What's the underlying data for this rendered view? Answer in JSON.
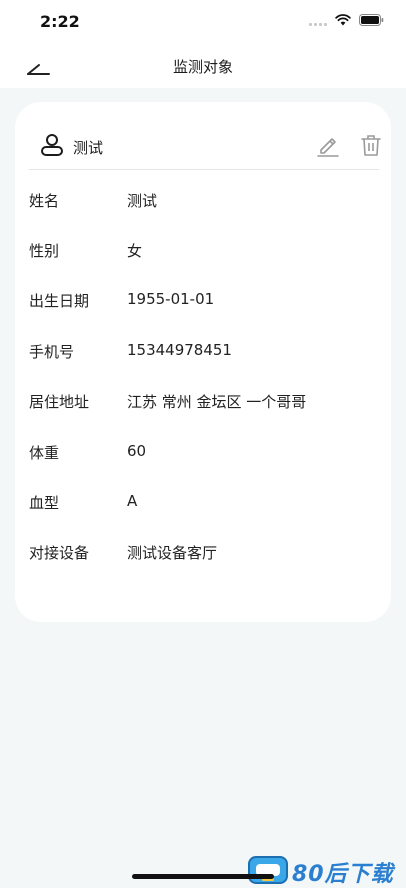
{
  "status_bar": {
    "time": "2:22"
  },
  "nav": {
    "title": "监测对象",
    "back_icon": "back-arrow-icon"
  },
  "profile_header": {
    "name": "测试",
    "icons": [
      "user-icon",
      "edit-icon",
      "trash-icon"
    ]
  },
  "details": [
    {
      "label": "姓名",
      "value": "测试"
    },
    {
      "label": "性别",
      "value": "女"
    },
    {
      "label": "出生日期",
      "value": "1955-01-01"
    },
    {
      "label": "手机号",
      "value": "15344978451"
    },
    {
      "label": "居住地址",
      "value": "江苏 常州 金坛区 一个哥哥"
    },
    {
      "label": "体重",
      "value": "60"
    },
    {
      "label": "血型",
      "value": "A"
    },
    {
      "label": "对接设备",
      "value": "测试设备客厅"
    }
  ],
  "watermark": {
    "text": "80后下载"
  },
  "colors": {
    "page_background": "#f3f7f8",
    "card_background": "#ffffff",
    "icon_gray": "#9a9a9a",
    "watermark_blue": "#2a7fd0"
  }
}
